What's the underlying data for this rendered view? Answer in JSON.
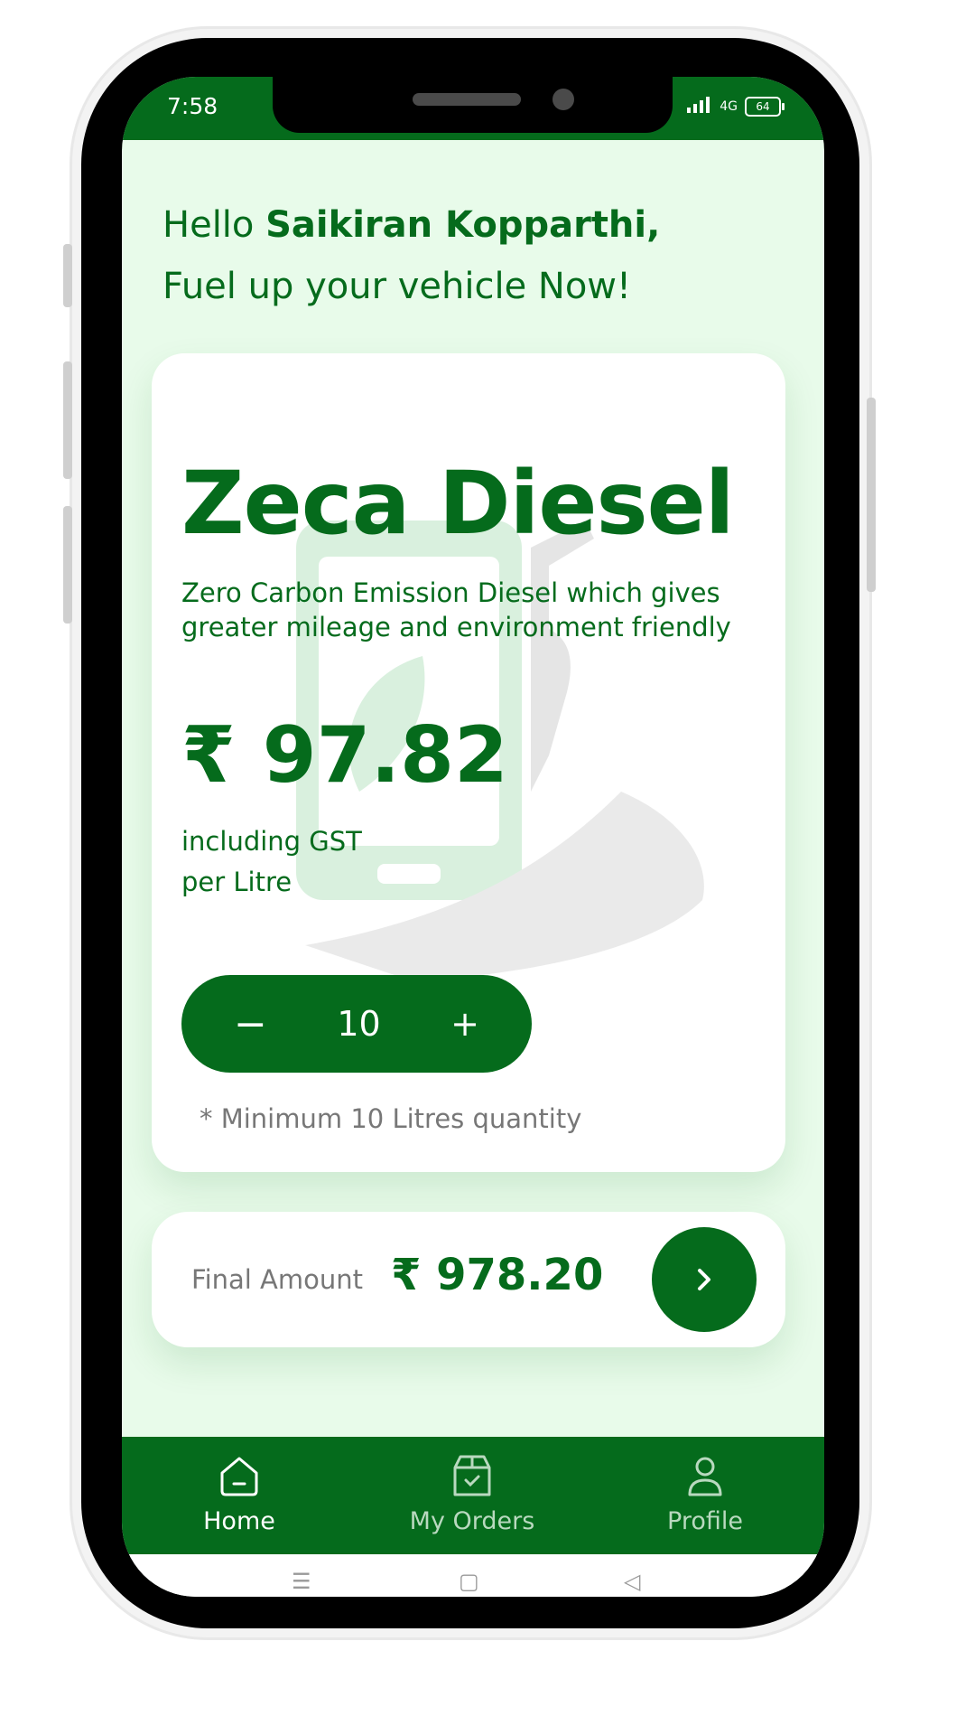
{
  "status_bar": {
    "time": "7:58",
    "network": "4G",
    "battery": "64"
  },
  "greeting": {
    "prefix": "Hello",
    "name": "Saikiran Kopparthi,",
    "line2": "Fuel up your vehicle Now!"
  },
  "product": {
    "title": "Zeca Diesel",
    "description": "Zero Carbon Emission Diesel which gives greater mileage and environment friendly",
    "price": "₹ 97.82",
    "price_note_1": "including GST",
    "price_note_2": "per Litre"
  },
  "quantity": {
    "minus": "−",
    "value": "10",
    "plus": "+",
    "min_note": "* Minimum 10 Litres quantity"
  },
  "amount": {
    "label": "Final Amount",
    "value": "₹ 978.20"
  },
  "nav": {
    "items": [
      {
        "label": "Home",
        "icon": "home-icon",
        "active": true
      },
      {
        "label": "My Orders",
        "icon": "orders-box-icon",
        "active": false
      },
      {
        "label": "Profile",
        "icon": "profile-icon",
        "active": false
      }
    ]
  },
  "colors": {
    "primary": "#056b1c",
    "background": "#e8fbea",
    "muted": "#777777"
  }
}
